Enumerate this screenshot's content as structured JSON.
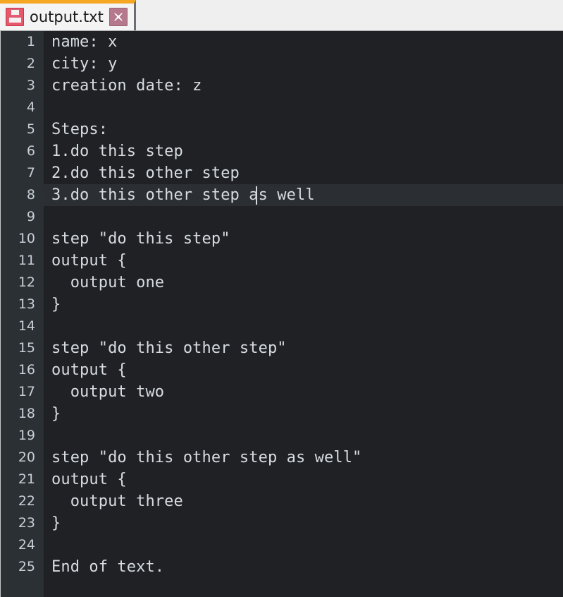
{
  "window": {
    "title": "output.txt"
  },
  "tab": {
    "filename": "output.txt",
    "save_icon": "floppy-disk-icon",
    "close_icon": "close-x-icon",
    "accent_color": "#f5a623",
    "close_bg_color": "#b5788c",
    "floppy_color": "#e8566a"
  },
  "editor": {
    "background_color": "#1f2124",
    "gutter_color": "#2b3035",
    "text_color": "#d7dce1",
    "lineno_color": "#c7cfd6",
    "current_line_color": "#2b2e33",
    "current_line": 8,
    "total_lines": 25,
    "cursor": {
      "line": 8,
      "column": 22
    },
    "lines": [
      {
        "n": "1",
        "text": "name: x"
      },
      {
        "n": "2",
        "text": "city: y"
      },
      {
        "n": "3",
        "text": "creation date: z"
      },
      {
        "n": "4",
        "text": ""
      },
      {
        "n": "5",
        "text": "Steps:"
      },
      {
        "n": "6",
        "text": "1.do this step"
      },
      {
        "n": "7",
        "text": "2.do this other step"
      },
      {
        "n": "8",
        "text": "3.do this other step as well"
      },
      {
        "n": "9",
        "text": ""
      },
      {
        "n": "10",
        "text": "step \"do this step\""
      },
      {
        "n": "11",
        "text": "output {"
      },
      {
        "n": "12",
        "text": "  output one"
      },
      {
        "n": "13",
        "text": "}"
      },
      {
        "n": "14",
        "text": ""
      },
      {
        "n": "15",
        "text": "step \"do this other step\""
      },
      {
        "n": "16",
        "text": "output {"
      },
      {
        "n": "17",
        "text": "  output two"
      },
      {
        "n": "18",
        "text": "}"
      },
      {
        "n": "19",
        "text": ""
      },
      {
        "n": "20",
        "text": "step \"do this other step as well\""
      },
      {
        "n": "21",
        "text": "output {"
      },
      {
        "n": "22",
        "text": "  output three"
      },
      {
        "n": "23",
        "text": "}"
      },
      {
        "n": "24",
        "text": ""
      },
      {
        "n": "25",
        "text": "End of text."
      }
    ]
  }
}
